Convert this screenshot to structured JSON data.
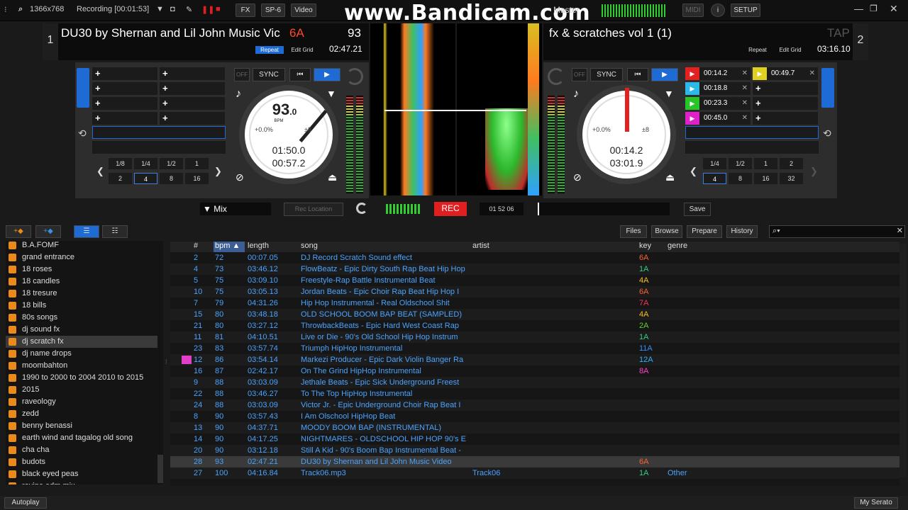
{
  "topbar": {
    "resolution": "1366x768",
    "recording": "Recording [00:01:53]",
    "fx": "FX",
    "sp6": "SP-6",
    "video": "Video",
    "watermark": "www.Bandicam.com",
    "master": "Master",
    "midi": "MIDI",
    "setup": "SETUP"
  },
  "deck1": {
    "number": "1",
    "title": "DU30 by Shernan and Lil John Music Vic",
    "key": "6A",
    "bpm": "93",
    "repeat": "Repeat",
    "edit_grid": "Edit Grid",
    "time": "02:47.21",
    "sync": "SYNC",
    "off": "OFF",
    "bpm_big": "93",
    "bpm_dec": ".0",
    "bpm_label": "BPM",
    "pitch": "+0.0%",
    "range": "±8",
    "elapsed": "01:50.0",
    "remain": "00:57.2",
    "loops_top": [
      "1/8",
      "1/4",
      "1/2",
      "1"
    ],
    "loops_bottom": [
      "2",
      "4",
      "8",
      "16"
    ]
  },
  "deck2": {
    "number": "2",
    "title": "fx & scratches vol 1 (1)",
    "tap": "TAP",
    "repeat": "Repeat",
    "edit_grid": "Edit Grid",
    "time": "03:16.10",
    "sync": "SYNC",
    "off": "OFF",
    "pitch": "+0.0%",
    "range": "±8",
    "elapsed": "00:14.2",
    "remain": "03:01.9",
    "cues": [
      {
        "time": "00:14.2",
        "color": "#e52020"
      },
      {
        "time": "00:18.8",
        "color": "#2db8e8"
      },
      {
        "time": "00:23.3",
        "color": "#28c428"
      },
      {
        "time": "00:45.0",
        "color": "#e020c8"
      }
    ],
    "cue5": {
      "time": "00:49.7",
      "color": "#e0d020"
    },
    "loops_top": [
      "1/4",
      "1/2",
      "1",
      "2"
    ],
    "loops_bottom": [
      "4",
      "8",
      "16",
      "32"
    ]
  },
  "mixbar": {
    "mix": "▼ Mix",
    "rec_location": "Rec Location",
    "rec": "REC",
    "rec_time": "01 52 06",
    "save": "Save"
  },
  "library": {
    "files": "Files",
    "browse": "Browse",
    "prepare": "Prepare",
    "history": "History",
    "search_placeholder": "",
    "columns": {
      "num": "#",
      "bpm": "bpm ▲",
      "length": "length",
      "song": "song",
      "artist": "artist",
      "key": "key",
      "genre": "genre"
    }
  },
  "crates": [
    "B.A.FOMF",
    "grand entrance",
    "18 roses",
    "18 candles",
    "18 tresure",
    "18 bills",
    "80s songs",
    " dj sound fx",
    "dj scratch fx",
    "dj name drops",
    "moombahton",
    "1990 to 2000 to 2004 2010 to 2015",
    "2015",
    "raveology",
    "zedd",
    "benny benassi",
    "earth wind and tagalog old song",
    "cha cha",
    "budots",
    "black eyed peas",
    "revine edm mix"
  ],
  "tracks": [
    {
      "num": "2",
      "bpm": "72",
      "length": "00:07.05",
      "song": "DJ Record Scratch Sound effect",
      "artist": "",
      "key": "6A",
      "keycolor": "#ff6030",
      "genre": ""
    },
    {
      "num": "4",
      "bpm": "73",
      "length": "03:46.12",
      "song": "FlowBeatz - Epic Dirty South Rap Beat Hip Hop",
      "artist": "",
      "key": "1A",
      "keycolor": "#30d080",
      "genre": ""
    },
    {
      "num": "5",
      "bpm": "75",
      "length": "03:09.10",
      "song": "Freestyle-Rap Battle Instrumental Beat",
      "artist": "",
      "key": "4A",
      "keycolor": "#f0c020",
      "genre": ""
    },
    {
      "num": "10",
      "bpm": "75",
      "length": "03:05.13",
      "song": "Jordan Beats - Epic Choir Rap Beat Hip Hop I",
      "artist": "",
      "key": "6A",
      "keycolor": "#ff6030",
      "genre": ""
    },
    {
      "num": "7",
      "bpm": "79",
      "length": "04:31.26",
      "song": "Hip Hop Instrumental - Real Oldschool Shit",
      "artist": "",
      "key": "7A",
      "keycolor": "#ff3050",
      "genre": ""
    },
    {
      "num": "15",
      "bpm": "80",
      "length": "03:48.18",
      "song": "OLD SCHOOL BOOM BAP BEAT (SAMPLED)",
      "artist": "",
      "key": "4A",
      "keycolor": "#f0c020",
      "genre": ""
    },
    {
      "num": "21",
      "bpm": "80",
      "length": "03:27.12",
      "song": "ThrowbackBeats - Epic Hard West Coast Rap",
      "artist": "",
      "key": "2A",
      "keycolor": "#60d030",
      "genre": ""
    },
    {
      "num": "11",
      "bpm": "81",
      "length": "04:10.51",
      "song": "Live or Die - 90's Old School Hip Hop Instrum",
      "artist": "",
      "key": "1A",
      "keycolor": "#30d080",
      "genre": ""
    },
    {
      "num": "23",
      "bpm": "83",
      "length": "03:57.74",
      "song": "Triumph HipHop Instrumental",
      "artist": "",
      "key": "11A",
      "keycolor": "#3090ff",
      "genre": ""
    },
    {
      "num": "12",
      "bpm": "86",
      "length": "03:54.14",
      "song": "Markezi Producer - Epic Dark Violin Banger Ra",
      "artist": "",
      "key": "12A",
      "keycolor": "#30b0ff",
      "genre": ""
    },
    {
      "num": "16",
      "bpm": "87",
      "length": "02:42.17",
      "song": "On The Grind HipHop Instrumental",
      "artist": "",
      "key": "8A",
      "keycolor": "#ff40c0",
      "genre": ""
    },
    {
      "num": "9",
      "bpm": "88",
      "length": "03:03.09",
      "song": "Jethale Beats - Epic Sick Underground Freest",
      "artist": "",
      "key": "",
      "keycolor": "#ffffff",
      "genre": ""
    },
    {
      "num": "22",
      "bpm": "88",
      "length": "03:46.27",
      "song": "To The Top HipHop Instrumental",
      "artist": "",
      "key": "",
      "keycolor": "#ffffff",
      "genre": ""
    },
    {
      "num": "24",
      "bpm": "88",
      "length": "03:03.09",
      "song": "Victor Jr. - Epic Underground Choir Rap Beat I",
      "artist": "",
      "key": "",
      "keycolor": "#ffffff",
      "genre": ""
    },
    {
      "num": "8",
      "bpm": "90",
      "length": "03:57.43",
      "song": "I Am Olschool HipHop Beat",
      "artist": "",
      "key": "",
      "keycolor": "#ffffff",
      "genre": ""
    },
    {
      "num": "13",
      "bpm": "90",
      "length": "04:37.71",
      "song": "MOODY BOOM BAP (INSTRUMENTAL)",
      "artist": "",
      "key": "",
      "keycolor": "#ffffff",
      "genre": ""
    },
    {
      "num": "14",
      "bpm": "90",
      "length": "04:17.25",
      "song": "NIGHTMARES - OLDSCHOOL HIP HOP 90's E",
      "artist": "",
      "key": "",
      "keycolor": "#ffffff",
      "genre": ""
    },
    {
      "num": "20",
      "bpm": "90",
      "length": "03:12.18",
      "song": "Still A Kid - 90's Boom Bap Instrumental Beat -",
      "artist": "",
      "key": "",
      "keycolor": "#ffffff",
      "genre": ""
    },
    {
      "num": "28",
      "bpm": "93",
      "length": "02:47.21",
      "song": "DU30 by Shernan and Lil John Music Video",
      "artist": "",
      "key": "6A",
      "keycolor": "#ff6030",
      "genre": ""
    },
    {
      "num": "27",
      "bpm": "100",
      "length": "04:16.84",
      "song": "Track06.mp3",
      "artist": "Track06",
      "key": "1A",
      "keycolor": "#30d080",
      "genre": "Other"
    }
  ],
  "bottombar": {
    "autoplay": "Autoplay",
    "my_serato": "My Serato"
  }
}
